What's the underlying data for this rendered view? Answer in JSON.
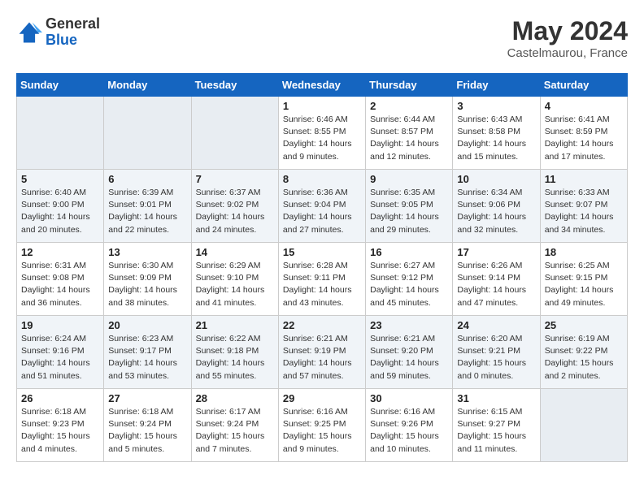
{
  "logo": {
    "general": "General",
    "blue": "Blue"
  },
  "header": {
    "month_year": "May 2024",
    "location": "Castelmaurou, France"
  },
  "weekdays": [
    "Sunday",
    "Monday",
    "Tuesday",
    "Wednesday",
    "Thursday",
    "Friday",
    "Saturday"
  ],
  "weeks": [
    [
      {
        "day": "",
        "info": ""
      },
      {
        "day": "",
        "info": ""
      },
      {
        "day": "",
        "info": ""
      },
      {
        "day": "1",
        "info": "Sunrise: 6:46 AM\nSunset: 8:55 PM\nDaylight: 14 hours\nand 9 minutes."
      },
      {
        "day": "2",
        "info": "Sunrise: 6:44 AM\nSunset: 8:57 PM\nDaylight: 14 hours\nand 12 minutes."
      },
      {
        "day": "3",
        "info": "Sunrise: 6:43 AM\nSunset: 8:58 PM\nDaylight: 14 hours\nand 15 minutes."
      },
      {
        "day": "4",
        "info": "Sunrise: 6:41 AM\nSunset: 8:59 PM\nDaylight: 14 hours\nand 17 minutes."
      }
    ],
    [
      {
        "day": "5",
        "info": "Sunrise: 6:40 AM\nSunset: 9:00 PM\nDaylight: 14 hours\nand 20 minutes."
      },
      {
        "day": "6",
        "info": "Sunrise: 6:39 AM\nSunset: 9:01 PM\nDaylight: 14 hours\nand 22 minutes."
      },
      {
        "day": "7",
        "info": "Sunrise: 6:37 AM\nSunset: 9:02 PM\nDaylight: 14 hours\nand 24 minutes."
      },
      {
        "day": "8",
        "info": "Sunrise: 6:36 AM\nSunset: 9:04 PM\nDaylight: 14 hours\nand 27 minutes."
      },
      {
        "day": "9",
        "info": "Sunrise: 6:35 AM\nSunset: 9:05 PM\nDaylight: 14 hours\nand 29 minutes."
      },
      {
        "day": "10",
        "info": "Sunrise: 6:34 AM\nSunset: 9:06 PM\nDaylight: 14 hours\nand 32 minutes."
      },
      {
        "day": "11",
        "info": "Sunrise: 6:33 AM\nSunset: 9:07 PM\nDaylight: 14 hours\nand 34 minutes."
      }
    ],
    [
      {
        "day": "12",
        "info": "Sunrise: 6:31 AM\nSunset: 9:08 PM\nDaylight: 14 hours\nand 36 minutes."
      },
      {
        "day": "13",
        "info": "Sunrise: 6:30 AM\nSunset: 9:09 PM\nDaylight: 14 hours\nand 38 minutes."
      },
      {
        "day": "14",
        "info": "Sunrise: 6:29 AM\nSunset: 9:10 PM\nDaylight: 14 hours\nand 41 minutes."
      },
      {
        "day": "15",
        "info": "Sunrise: 6:28 AM\nSunset: 9:11 PM\nDaylight: 14 hours\nand 43 minutes."
      },
      {
        "day": "16",
        "info": "Sunrise: 6:27 AM\nSunset: 9:12 PM\nDaylight: 14 hours\nand 45 minutes."
      },
      {
        "day": "17",
        "info": "Sunrise: 6:26 AM\nSunset: 9:14 PM\nDaylight: 14 hours\nand 47 minutes."
      },
      {
        "day": "18",
        "info": "Sunrise: 6:25 AM\nSunset: 9:15 PM\nDaylight: 14 hours\nand 49 minutes."
      }
    ],
    [
      {
        "day": "19",
        "info": "Sunrise: 6:24 AM\nSunset: 9:16 PM\nDaylight: 14 hours\nand 51 minutes."
      },
      {
        "day": "20",
        "info": "Sunrise: 6:23 AM\nSunset: 9:17 PM\nDaylight: 14 hours\nand 53 minutes."
      },
      {
        "day": "21",
        "info": "Sunrise: 6:22 AM\nSunset: 9:18 PM\nDaylight: 14 hours\nand 55 minutes."
      },
      {
        "day": "22",
        "info": "Sunrise: 6:21 AM\nSunset: 9:19 PM\nDaylight: 14 hours\nand 57 minutes."
      },
      {
        "day": "23",
        "info": "Sunrise: 6:21 AM\nSunset: 9:20 PM\nDaylight: 14 hours\nand 59 minutes."
      },
      {
        "day": "24",
        "info": "Sunrise: 6:20 AM\nSunset: 9:21 PM\nDaylight: 15 hours\nand 0 minutes."
      },
      {
        "day": "25",
        "info": "Sunrise: 6:19 AM\nSunset: 9:22 PM\nDaylight: 15 hours\nand 2 minutes."
      }
    ],
    [
      {
        "day": "26",
        "info": "Sunrise: 6:18 AM\nSunset: 9:23 PM\nDaylight: 15 hours\nand 4 minutes."
      },
      {
        "day": "27",
        "info": "Sunrise: 6:18 AM\nSunset: 9:24 PM\nDaylight: 15 hours\nand 5 minutes."
      },
      {
        "day": "28",
        "info": "Sunrise: 6:17 AM\nSunset: 9:24 PM\nDaylight: 15 hours\nand 7 minutes."
      },
      {
        "day": "29",
        "info": "Sunrise: 6:16 AM\nSunset: 9:25 PM\nDaylight: 15 hours\nand 9 minutes."
      },
      {
        "day": "30",
        "info": "Sunrise: 6:16 AM\nSunset: 9:26 PM\nDaylight: 15 hours\nand 10 minutes."
      },
      {
        "day": "31",
        "info": "Sunrise: 6:15 AM\nSunset: 9:27 PM\nDaylight: 15 hours\nand 11 minutes."
      },
      {
        "day": "",
        "info": ""
      }
    ]
  ]
}
